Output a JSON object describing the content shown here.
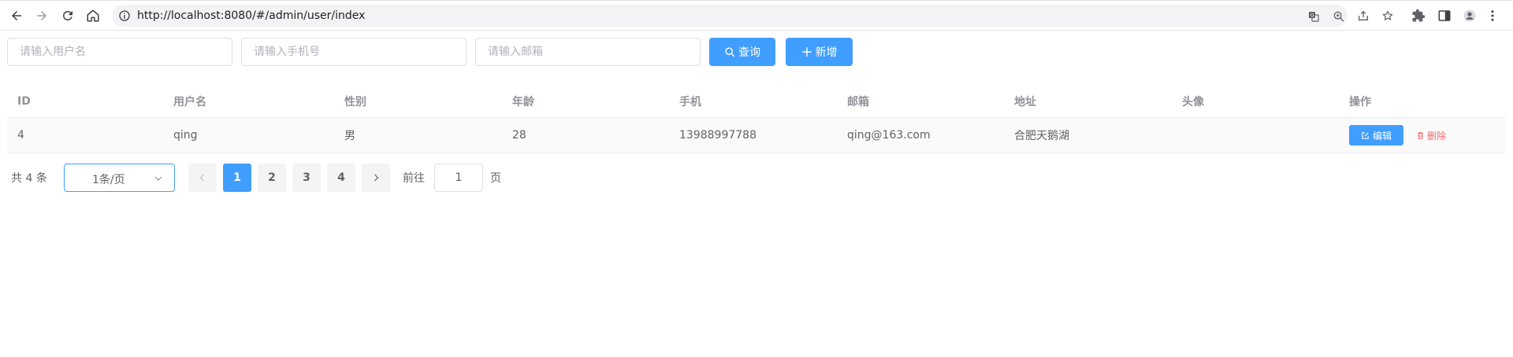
{
  "browser": {
    "url": "http://localhost:8080/#/admin/user/index",
    "icons": [
      "back-icon",
      "forward-icon",
      "reload-icon",
      "home-icon",
      "info-icon",
      "translate-icon",
      "zoom-icon",
      "share-icon",
      "star-icon",
      "extensions-icon",
      "sidepanel-icon",
      "profile-icon",
      "menu-icon"
    ]
  },
  "search": {
    "username_placeholder": "请输入用户名",
    "phone_placeholder": "请输入手机号",
    "email_placeholder": "请输入邮箱",
    "query_label": "查询",
    "add_label": "新增"
  },
  "table": {
    "headers": {
      "id": "ID",
      "username": "用户名",
      "gender": "性别",
      "age": "年龄",
      "phone": "手机",
      "email": "邮箱",
      "address": "地址",
      "avatar": "头像",
      "actions": "操作"
    },
    "rows": [
      {
        "id": "4",
        "username": "qing",
        "gender": "男",
        "age": "28",
        "phone": "13988997788",
        "email": "qing@163.com",
        "address": "合肥天鹅湖",
        "avatar": ""
      }
    ],
    "edit_label": "编辑",
    "delete_label": "删除"
  },
  "pagination": {
    "total_text": "共 4 条",
    "page_size": "1条/页",
    "pages": [
      "1",
      "2",
      "3",
      "4"
    ],
    "current_page": "1",
    "goto_label": "前往",
    "goto_value": "1",
    "page_suffix": "页"
  },
  "colors": {
    "primary": "#409eff",
    "danger": "#f56c6c",
    "header_text": "#909399",
    "body_text": "#606266"
  }
}
